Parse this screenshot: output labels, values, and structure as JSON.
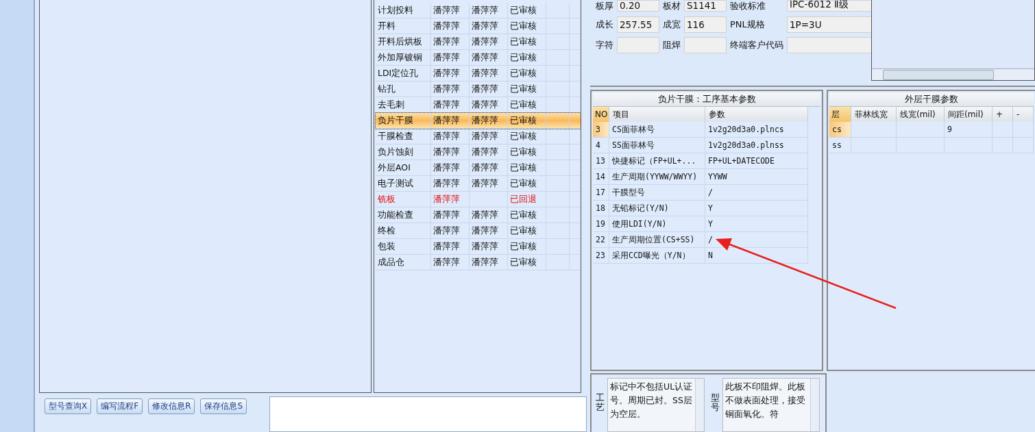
{
  "process_table": {
    "rows": [
      {
        "step": "计划投料",
        "col_2": "潘萍萍",
        "col_3": "潘萍萍",
        "status": "已审核",
        "selected": false,
        "returned": false
      },
      {
        "step": "开料",
        "col_2": "潘萍萍",
        "col_3": "潘萍萍",
        "status": "已审核",
        "selected": false,
        "returned": false
      },
      {
        "step": "开料后烘板",
        "col_2": "潘萍萍",
        "col_3": "潘萍萍",
        "status": "已审核",
        "selected": false,
        "returned": false
      },
      {
        "step": "外加厚镀铜",
        "col_2": "潘萍萍",
        "col_3": "潘萍萍",
        "status": "已审核",
        "selected": false,
        "returned": false
      },
      {
        "step": "LDI定位孔",
        "col_2": "潘萍萍",
        "col_3": "潘萍萍",
        "status": "已审核",
        "selected": false,
        "returned": false
      },
      {
        "step": "钻孔",
        "col_2": "潘萍萍",
        "col_3": "潘萍萍",
        "status": "已审核",
        "selected": false,
        "returned": false
      },
      {
        "step": "去毛刺",
        "col_2": "潘萍萍",
        "col_3": "潘萍萍",
        "status": "已审核",
        "selected": false,
        "returned": false
      },
      {
        "step": "负片干膜",
        "col_2": "潘萍萍",
        "col_3": "潘萍萍",
        "status": "已审核",
        "selected": true,
        "returned": false
      },
      {
        "step": "干膜检查",
        "col_2": "潘萍萍",
        "col_3": "潘萍萍",
        "status": "已审核",
        "selected": false,
        "returned": false
      },
      {
        "step": "负片蚀刻",
        "col_2": "潘萍萍",
        "col_3": "潘萍萍",
        "status": "已审核",
        "selected": false,
        "returned": false
      },
      {
        "step": "外层AOI",
        "col_2": "潘萍萍",
        "col_3": "潘萍萍",
        "status": "已审核",
        "selected": false,
        "returned": false
      },
      {
        "step": "电子测试",
        "col_2": "潘萍萍",
        "col_3": "潘萍萍",
        "status": "已审核",
        "selected": false,
        "returned": false
      },
      {
        "step": "铣板",
        "col_2": "潘萍萍",
        "status": "已回退",
        "selected": false,
        "returned": true
      },
      {
        "step": "功能检查",
        "col_2": "潘萍萍",
        "col_3": "潘萍萍",
        "status": "已审核",
        "selected": false,
        "returned": false
      },
      {
        "step": "终检",
        "col_2": "潘萍萍",
        "col_3": "潘萍萍",
        "status": "已审核",
        "selected": false,
        "returned": false
      },
      {
        "step": "包装",
        "col_2": "潘萍萍",
        "col_3": "潘萍萍",
        "status": "已审核",
        "selected": false,
        "returned": false
      },
      {
        "step": "成品仓",
        "col_2": "潘萍萍",
        "col_3": "潘萍萍",
        "status": "已审核",
        "selected": false,
        "returned": false
      }
    ]
  },
  "buttons": [
    "型号查询X",
    "编写流程F",
    "修改信息R",
    "保存信息S"
  ],
  "info_fields": [
    {
      "label": "板厚",
      "value": "0.20"
    },
    {
      "label": "板材",
      "value": "S1141"
    },
    {
      "label": "验收标准",
      "value": "IPC-6012 Ⅱ级"
    },
    {
      "label": "成长",
      "value": "257.55"
    },
    {
      "label": "成宽",
      "value": "116"
    },
    {
      "label": "PNL规格",
      "value": "1P=3U"
    },
    {
      "label": "字符"
    },
    {
      "label": "阻焊"
    },
    {
      "label": "终端客户代码"
    }
  ],
  "param_panel": {
    "title": "负片干膜：工序基本参数",
    "columns": [
      "NO",
      "项目",
      "参数"
    ],
    "rows": [
      {
        "no": "3",
        "item": "CS面菲林号",
        "value": "1v2g20d3a0.plncs",
        "selected": true
      },
      {
        "no": "4",
        "item": "SS面菲林号",
        "value": "1v2g20d3a0.plnss",
        "selected": false
      },
      {
        "no": "13",
        "item": "快捷标记（FP+UL+...",
        "value": "FP+UL+DATECODE",
        "selected": false
      },
      {
        "no": "14",
        "item": "生产周期(YYWW/WWYY)",
        "value": "YYWW",
        "selected": false
      },
      {
        "no": "17",
        "item": "干膜型号",
        "value": "/",
        "selected": false
      },
      {
        "no": "18",
        "item": "无铅标记(Y/N)",
        "value": "Y",
        "selected": false
      },
      {
        "no": "19",
        "item": "使用LDI(Y/N)",
        "value": "Y",
        "selected": false
      },
      {
        "no": "22",
        "item": "生产周期位置(CS+SS)",
        "value": "/",
        "selected": false
      },
      {
        "no": "23",
        "item": "采用CCD曝光（Y/N）",
        "value": "N",
        "selected": false
      }
    ]
  },
  "outer_panel": {
    "title": "外层干膜参数",
    "columns": [
      "层",
      "菲林线宽",
      "线宽(mil)",
      "间距(mil)",
      "+",
      "-"
    ],
    "rows": [
      {
        "layer": "cs",
        "spacing": "9",
        "selected": true
      },
      {
        "layer": "ss",
        "selected": false
      }
    ]
  },
  "notes": [
    {
      "label": "工艺",
      "text": "标记中不包括UL认证号。周期已封。SS层为空层。"
    },
    {
      "label": "型号",
      "text": "此板不印阻焊。此板不做表面处理，接受铜面氧化。符"
    }
  ]
}
